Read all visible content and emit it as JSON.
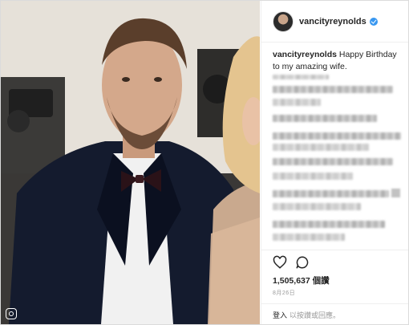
{
  "post": {
    "username": "vancityreynolds",
    "verified": true,
    "caption_user": "vancityreynolds",
    "caption_text": "Happy Birthday to my amazing wife.",
    "likes": "1,505,637 個讚",
    "date": "8月26日"
  },
  "footer": {
    "login_link": "登入",
    "login_rest": "以按讚或回應。"
  },
  "icons": {
    "like": "heart-icon",
    "comment": "comment-bubble-icon",
    "verified": "verified-badge-icon",
    "instagram": "instagram-glyph-icon"
  },
  "colors": {
    "accent_blue": "#3897f0",
    "text_primary": "#262626",
    "text_secondary": "#999999",
    "border": "#efefef"
  }
}
